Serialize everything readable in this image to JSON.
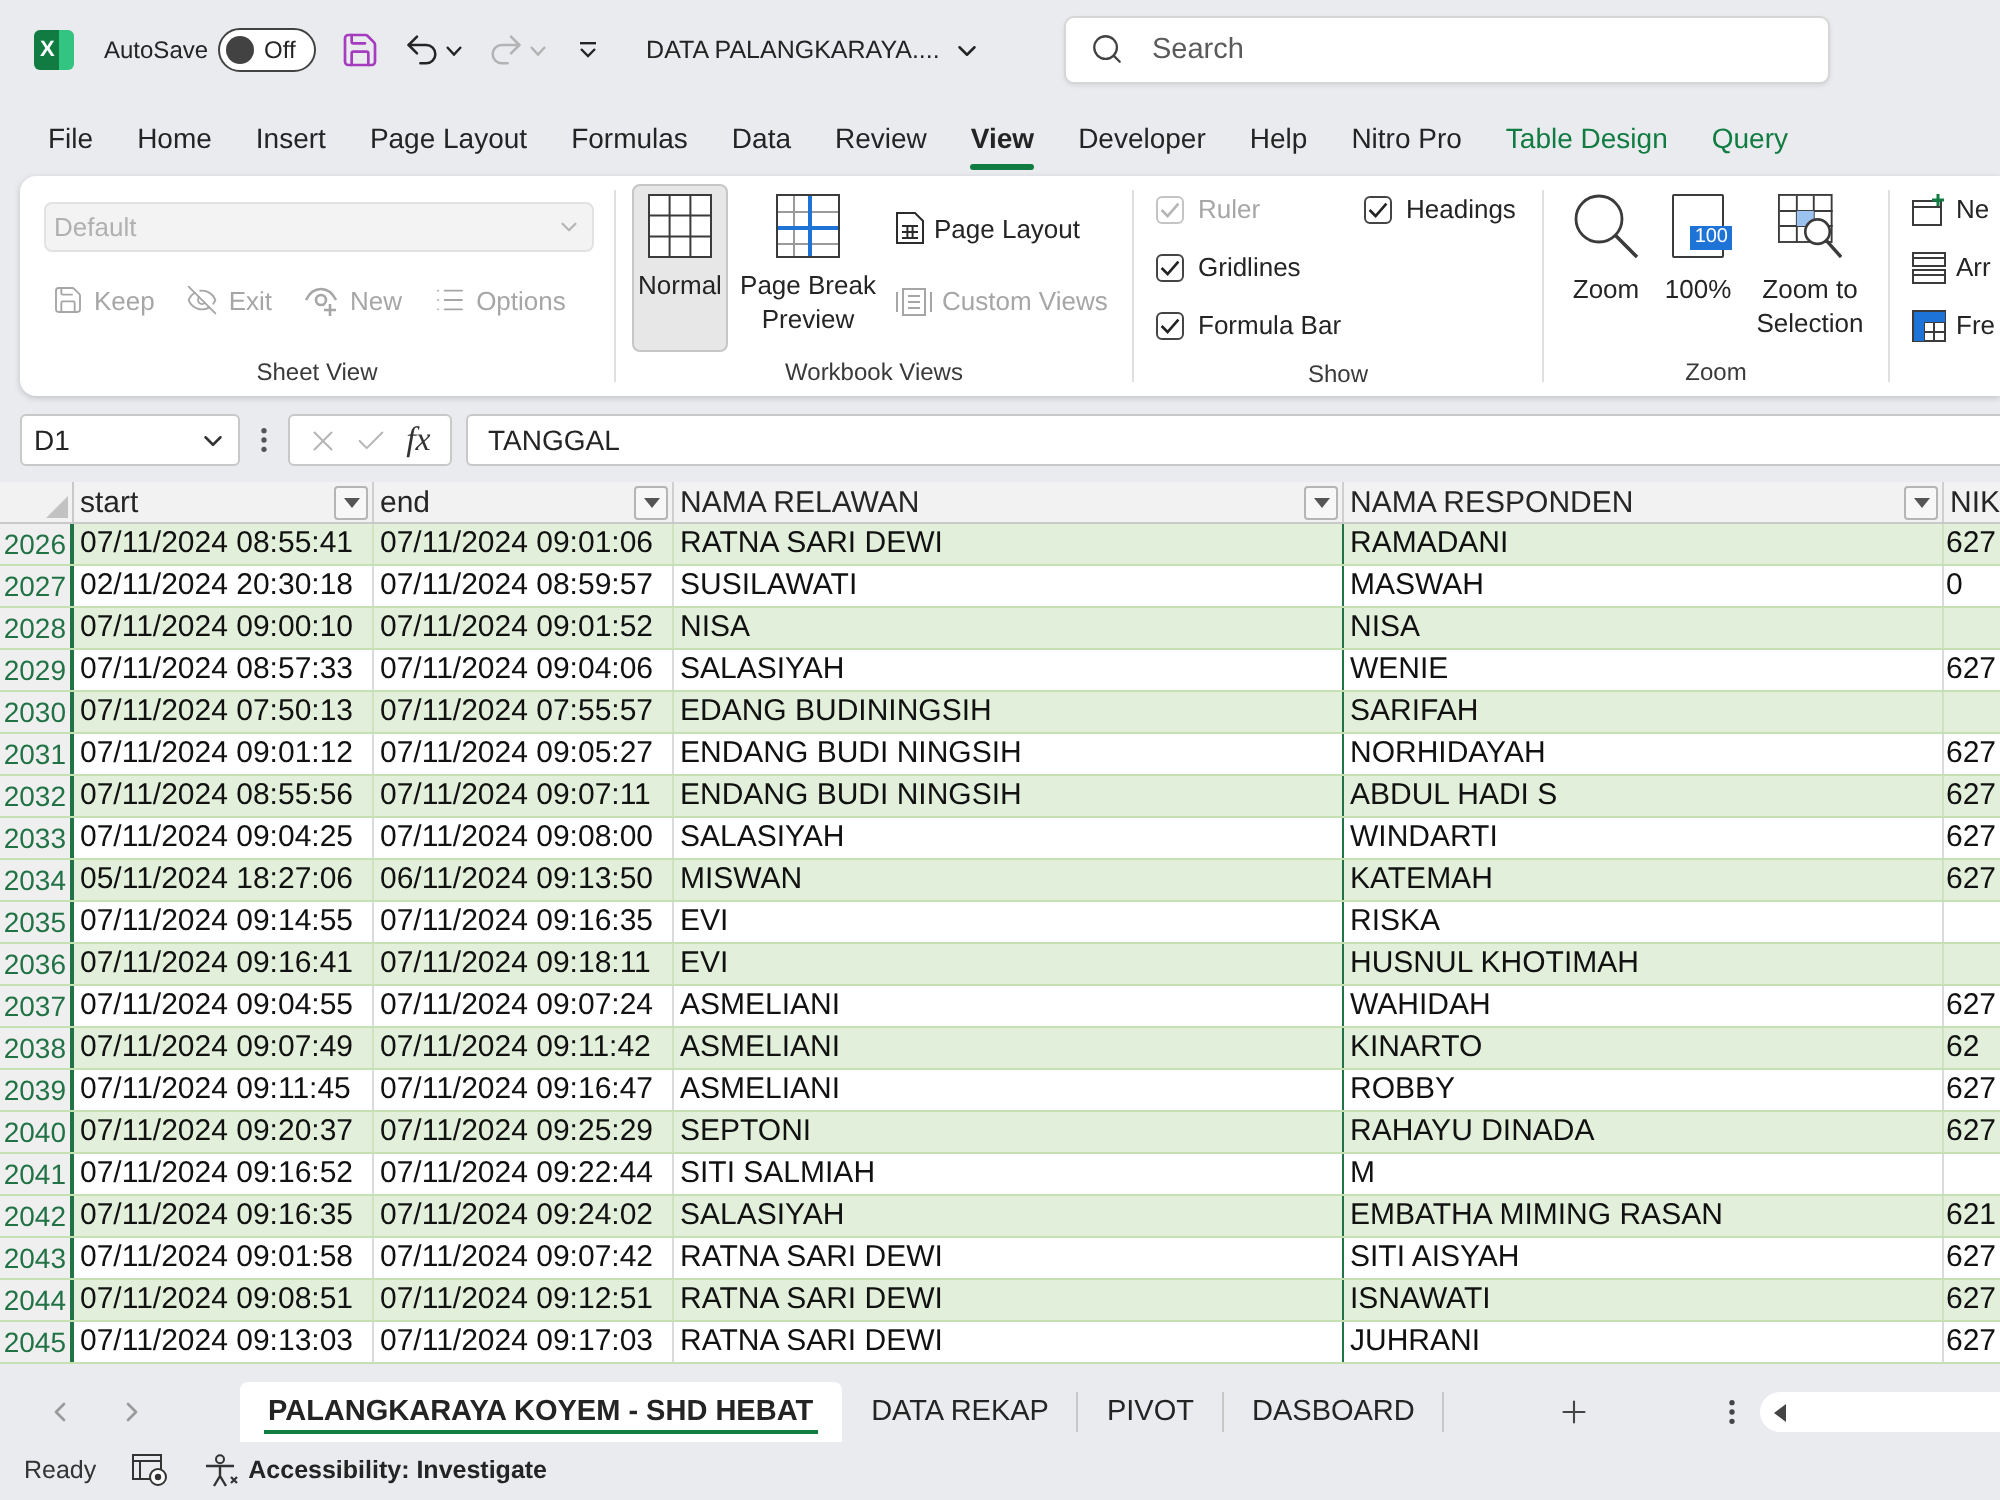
{
  "title_bar": {
    "logo": "X",
    "autosave": {
      "label": "AutoSave",
      "state_label": "Off",
      "on": false
    },
    "undo": {
      "disabled": false
    },
    "redo": {
      "disabled": true
    },
    "document_title": "DATA PALANGKARAYA....",
    "search": {
      "placeholder": "Search"
    }
  },
  "ribbon_tabs": [
    {
      "label": "File",
      "kind": "standard",
      "selected": false
    },
    {
      "label": "Home",
      "kind": "standard",
      "selected": false
    },
    {
      "label": "Insert",
      "kind": "standard",
      "selected": false
    },
    {
      "label": "Page Layout",
      "kind": "standard",
      "selected": false
    },
    {
      "label": "Formulas",
      "kind": "standard",
      "selected": false
    },
    {
      "label": "Data",
      "kind": "standard",
      "selected": false
    },
    {
      "label": "Review",
      "kind": "standard",
      "selected": false
    },
    {
      "label": "View",
      "kind": "standard",
      "selected": true
    },
    {
      "label": "Developer",
      "kind": "standard",
      "selected": false
    },
    {
      "label": "Help",
      "kind": "standard",
      "selected": false
    },
    {
      "label": "Nitro Pro",
      "kind": "standard",
      "selected": false
    },
    {
      "label": "Table Design",
      "kind": "contextual",
      "selected": false
    },
    {
      "label": "Query",
      "kind": "contextual",
      "selected": false
    }
  ],
  "ribbon": {
    "sheet_view": {
      "label": "Sheet View",
      "dropdown": {
        "value": "Default",
        "disabled": true
      },
      "buttons": [
        {
          "label": "Keep",
          "disabled": true
        },
        {
          "label": "Exit",
          "disabled": true
        },
        {
          "label": "New",
          "disabled": true
        },
        {
          "label": "Options",
          "disabled": true
        }
      ]
    },
    "workbook_views": {
      "label": "Workbook Views",
      "large_buttons": [
        {
          "label": "Normal",
          "selected": true
        },
        {
          "label": "Page Break Preview",
          "selected": false
        }
      ],
      "small_buttons": [
        {
          "label": "Page Layout",
          "disabled": false
        },
        {
          "label": "Custom Views",
          "disabled": true
        }
      ]
    },
    "show": {
      "label": "Show",
      "options": [
        {
          "label": "Ruler",
          "checked": true,
          "disabled": true
        },
        {
          "label": "Gridlines",
          "checked": true,
          "disabled": false
        },
        {
          "label": "Formula Bar",
          "checked": true,
          "disabled": false
        },
        {
          "label": "Headings",
          "checked": true,
          "disabled": false
        }
      ]
    },
    "zoom": {
      "label": "Zoom",
      "buttons": [
        {
          "label": "Zoom"
        },
        {
          "label": "100%",
          "icon_text": "100"
        },
        {
          "label": "Zoom to Selection"
        }
      ]
    },
    "window": {
      "buttons": [
        {
          "label": "Ne"
        },
        {
          "label": "Arr"
        },
        {
          "label": "Fre"
        }
      ]
    }
  },
  "formula_bar": {
    "name_box": "D1",
    "editing": false,
    "function_label": "fx",
    "value": "TANGGAL"
  },
  "sheet": {
    "filtered": true,
    "banded_rows": true,
    "columns": [
      {
        "label": "start",
        "filter": true
      },
      {
        "label": "end",
        "filter": true
      },
      {
        "label": "NAMA RELAWAN",
        "filter": true
      },
      {
        "label": "NAMA RESPONDEN",
        "filter": true
      },
      {
        "label": "NIK",
        "filter": false
      }
    ],
    "rows": [
      {
        "row": "2026",
        "start": "07/11/2024 08:55:41",
        "end": "07/11/2024 09:01:06",
        "nama_relawan": "RATNA SARI DEWI",
        "nama_responden": "RAMADANI",
        "nik": "627"
      },
      {
        "row": "2027",
        "start": "02/11/2024 20:30:18",
        "end": "07/11/2024 08:59:57",
        "nama_relawan": "SUSILAWATI",
        "nama_responden": "MASWAH",
        "nik": "0"
      },
      {
        "row": "2028",
        "start": "07/11/2024 09:00:10",
        "end": "07/11/2024 09:01:52",
        "nama_relawan": "NISA",
        "nama_responden": "NISA"
      },
      {
        "row": "2029",
        "start": "07/11/2024 08:57:33",
        "end": "07/11/2024 09:04:06",
        "nama_relawan": "SALASIYAH",
        "nama_responden": "WENIE",
        "nik": "627"
      },
      {
        "row": "2030",
        "start": "07/11/2024 07:50:13",
        "end": "07/11/2024 07:55:57",
        "nama_relawan": "EDANG BUDININGSIH",
        "nama_responden": "SARIFAH"
      },
      {
        "row": "2031",
        "start": "07/11/2024 09:01:12",
        "end": "07/11/2024 09:05:27",
        "nama_relawan": "ENDANG BUDI NINGSIH",
        "nama_responden": "NORHIDAYAH",
        "nik": "627"
      },
      {
        "row": "2032",
        "start": "07/11/2024 08:55:56",
        "end": "07/11/2024 09:07:11",
        "nama_relawan": "ENDANG BUDI NINGSIH",
        "nama_responden": "ABDUL HADI S",
        "nik": "627"
      },
      {
        "row": "2033",
        "start": "07/11/2024 09:04:25",
        "end": "07/11/2024 09:08:00",
        "nama_relawan": "SALASIYAH",
        "nama_responden": "WINDARTI",
        "nik": "627"
      },
      {
        "row": "2034",
        "start": "05/11/2024 18:27:06",
        "end": "06/11/2024 09:13:50",
        "nama_relawan": "MISWAN",
        "nama_responden": "KATEMAH",
        "nik": "627"
      },
      {
        "row": "2035",
        "start": "07/11/2024 09:14:55",
        "end": "07/11/2024 09:16:35",
        "nama_relawan": "EVI",
        "nama_responden": "RISKA"
      },
      {
        "row": "2036",
        "start": "07/11/2024 09:16:41",
        "end": "07/11/2024 09:18:11",
        "nama_relawan": "EVI",
        "nama_responden": "HUSNUL KHOTIMAH"
      },
      {
        "row": "2037",
        "start": "07/11/2024 09:04:55",
        "end": "07/11/2024 09:07:24",
        "nama_relawan": "ASMELIANI",
        "nama_responden": "WAHIDAH",
        "nik": "627"
      },
      {
        "row": "2038",
        "start": "07/11/2024 09:07:49",
        "end": "07/11/2024 09:11:42",
        "nama_relawan": "ASMELIANI",
        "nama_responden": "KINARTO",
        "nik": "62"
      },
      {
        "row": "2039",
        "start": "07/11/2024 09:11:45",
        "end": "07/11/2024 09:16:47",
        "nama_relawan": "ASMELIANI",
        "nama_responden": "ROBBY",
        "nik": "627"
      },
      {
        "row": "2040",
        "start": "07/11/2024 09:20:37",
        "end": "07/11/2024 09:25:29",
        "nama_relawan": "SEPTONI",
        "nama_responden": "RAHAYU DINADA",
        "nik": "627"
      },
      {
        "row": "2041",
        "start": "07/11/2024 09:16:52",
        "end": "07/11/2024 09:22:44",
        "nama_relawan": "SITI SALMIAH",
        "nama_responden": "M"
      },
      {
        "row": "2042",
        "start": "07/11/2024 09:16:35",
        "end": "07/11/2024 09:24:02",
        "nama_relawan": "SALASIYAH",
        "nama_responden": "EMBATHA MIMING RASAN",
        "nik": "621"
      },
      {
        "row": "2043",
        "start": "07/11/2024 09:01:58",
        "end": "07/11/2024 09:07:42",
        "nama_relawan": "RATNA SARI DEWI",
        "nama_responden": "SITI AISYAH",
        "nik": "627"
      },
      {
        "row": "2044",
        "start": "07/11/2024 09:08:51",
        "end": "07/11/2024 09:12:51",
        "nama_relawan": "RATNA SARI DEWI",
        "nama_responden": "ISNAWATI",
        "nik": "627"
      },
      {
        "row": "2045",
        "start": "07/11/2024 09:13:03",
        "end": "07/11/2024 09:17:03",
        "nama_relawan": "RATNA SARI DEWI",
        "nama_responden": "JUHRANI",
        "nik": "627"
      }
    ]
  },
  "sheet_tabs": [
    {
      "label": "PALANGKARAYA KOYEM - SHD HEBAT",
      "selected": true
    },
    {
      "label": "DATA REKAP",
      "selected": false
    },
    {
      "label": "PIVOT",
      "selected": false
    },
    {
      "label": "DASBOARD",
      "selected": false
    }
  ],
  "status_bar": {
    "mode": "Ready",
    "accessibility": "Accessibility: Investigate"
  }
}
